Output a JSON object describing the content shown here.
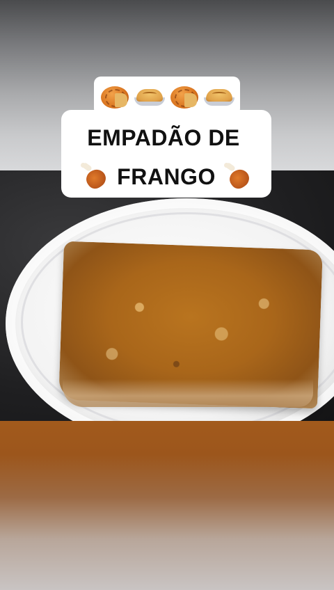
{
  "caption": {
    "line1": "EMPADÃO DE",
    "line2": "FRANGO",
    "emojis_top": [
      "mooncake-icon",
      "pie-icon",
      "mooncake-icon",
      "pie-icon"
    ],
    "emojis_side": [
      "drumstick-icon",
      "drumstick-icon"
    ]
  },
  "colors": {
    "caption_bg": "#ffffff",
    "caption_text": "#111111",
    "pie_crust": "#a9661a",
    "plate": "#f3f3f3",
    "countertop": "#1f1f21"
  }
}
